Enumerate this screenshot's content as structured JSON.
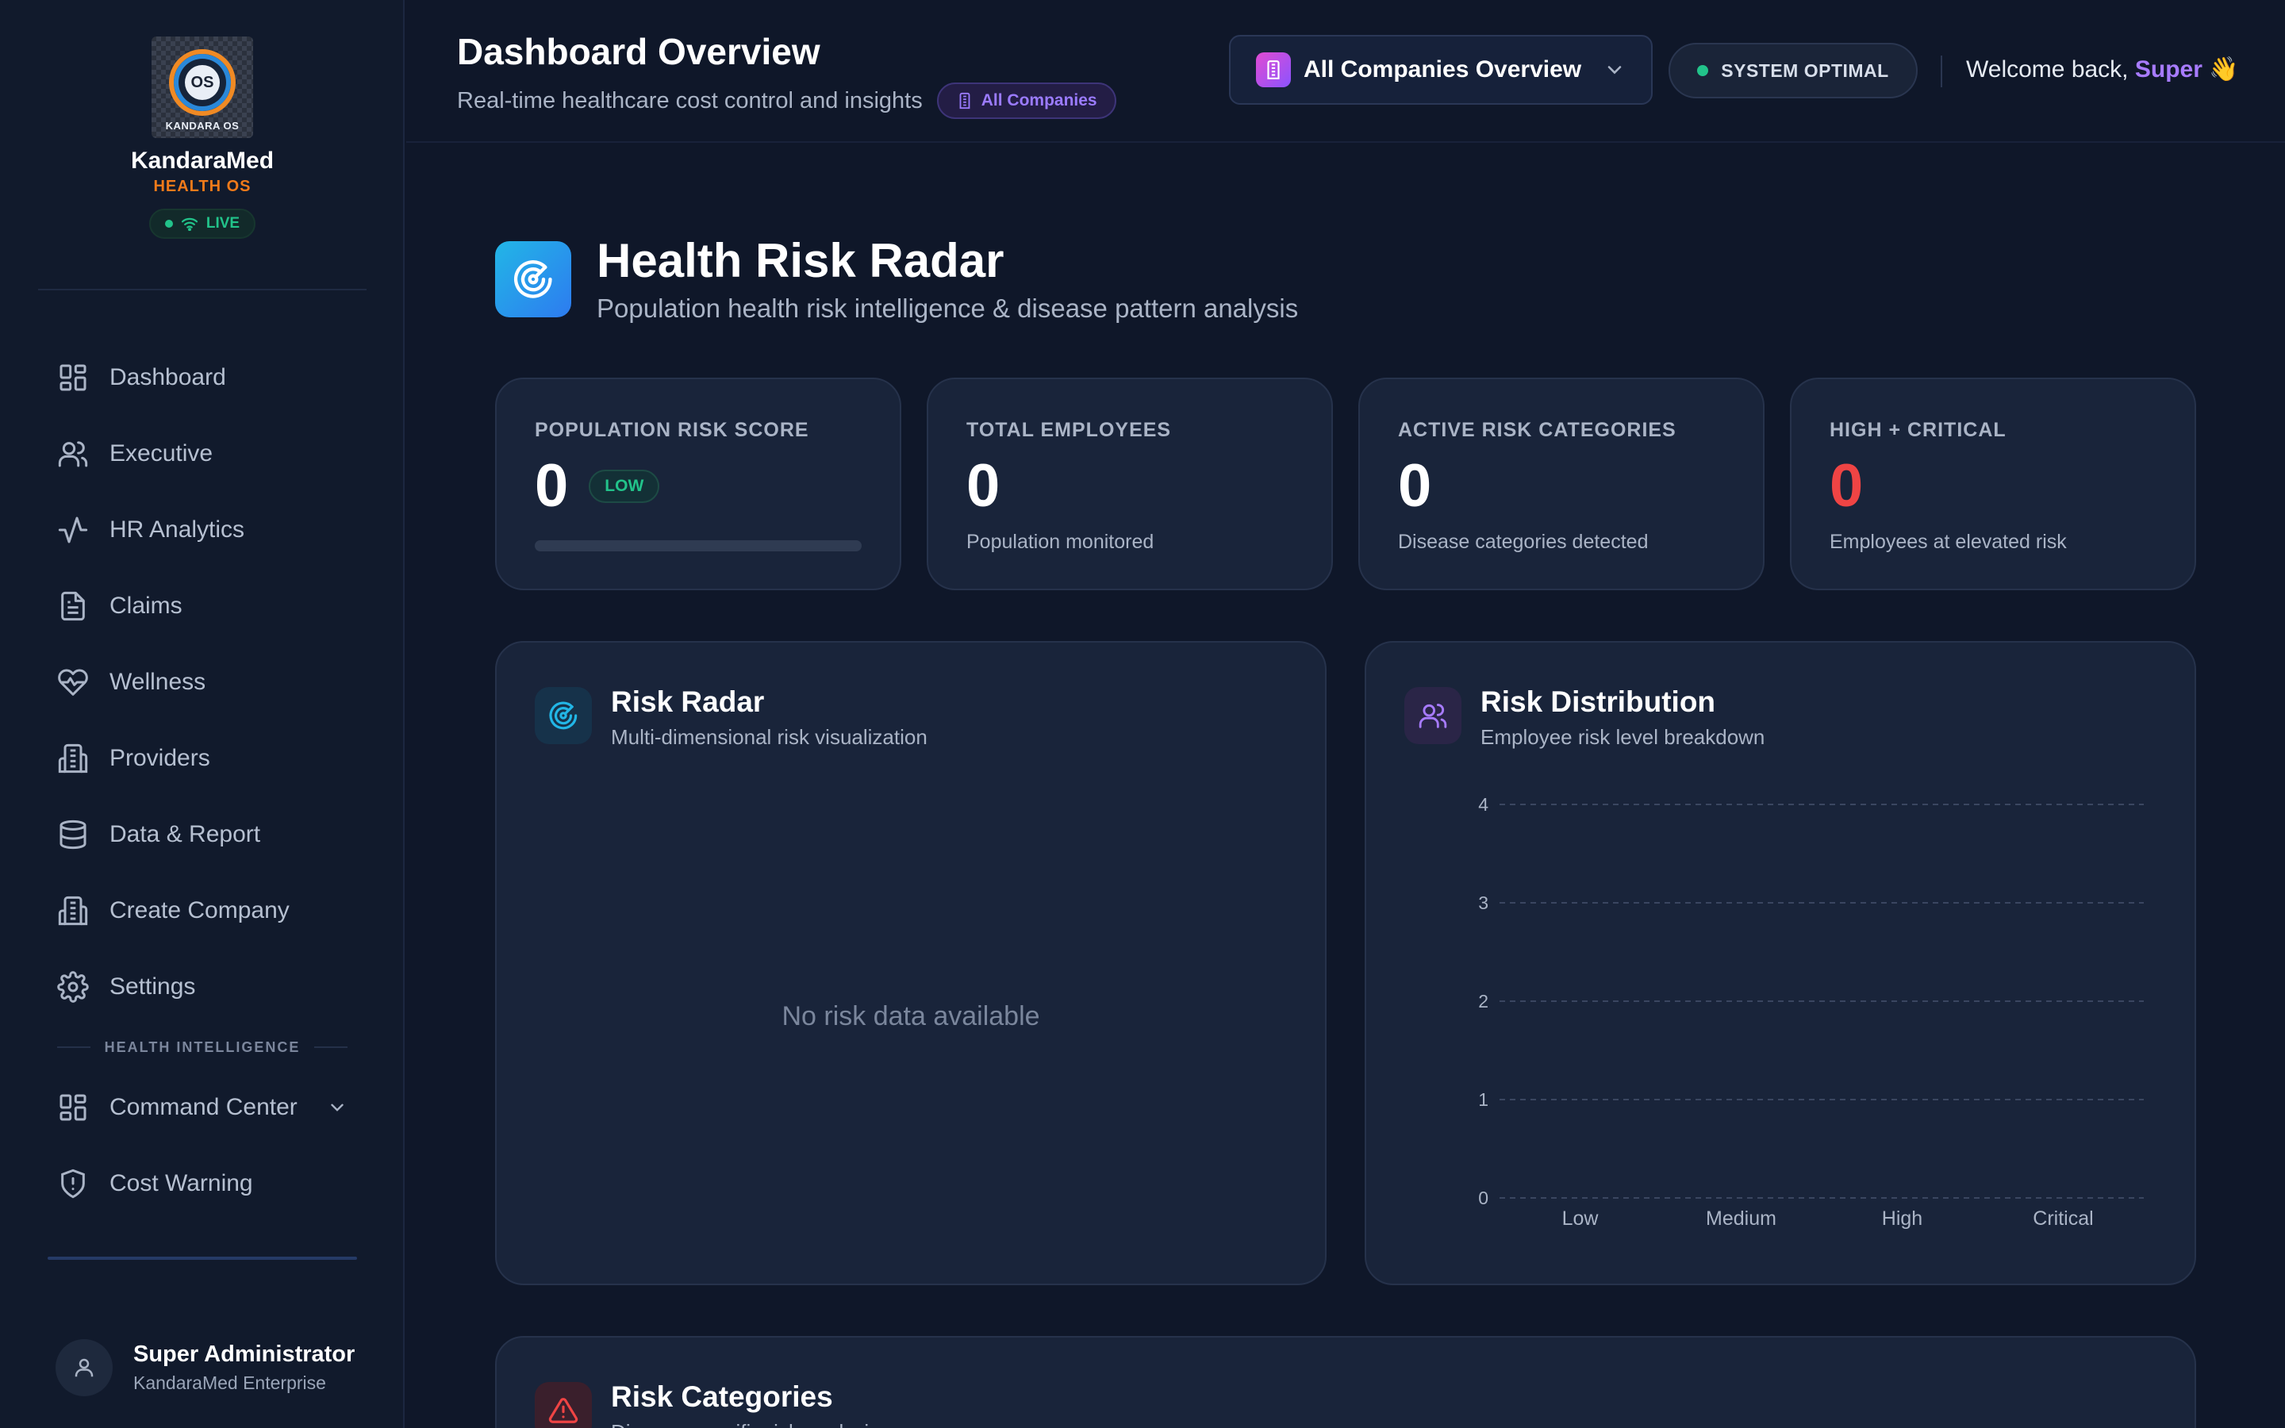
{
  "brand": {
    "logo_text": "OS",
    "logo_caption": "KANDARA OS",
    "name": "KandaraMed",
    "subtitle": "HEALTH OS",
    "live_label": "LIVE"
  },
  "sidebar": {
    "items": [
      {
        "label": "Dashboard",
        "icon": "dashboard-grid-icon"
      },
      {
        "label": "Executive",
        "icon": "users-icon"
      },
      {
        "label": "HR Analytics",
        "icon": "activity-icon"
      },
      {
        "label": "Claims",
        "icon": "document-icon"
      },
      {
        "label": "Wellness",
        "icon": "heart-pulse-icon"
      },
      {
        "label": "Providers",
        "icon": "building-icon"
      },
      {
        "label": "Data & Report",
        "icon": "database-icon"
      },
      {
        "label": "Create Company",
        "icon": "building-icon"
      },
      {
        "label": "Settings",
        "icon": "gear-icon"
      }
    ],
    "section_label": "HEALTH INTELLIGENCE",
    "intel_items": [
      {
        "label": "Command Center",
        "icon": "dashboard-grid-icon"
      },
      {
        "label": "Cost Warning",
        "icon": "shield-alert-icon"
      }
    ],
    "user": {
      "name": "Super Administrator",
      "org": "KandaraMed Enterprise"
    }
  },
  "header": {
    "title": "Dashboard Overview",
    "subtitle": "Real-time healthcare cost control and insights",
    "company_badge": "All Companies",
    "company_select": "All Companies Overview",
    "status": "SYSTEM OPTIMAL",
    "welcome_prefix": "Welcome back,",
    "welcome_name": "Super",
    "welcome_emoji": "👋"
  },
  "hero": {
    "title": "Health Risk Radar",
    "subtitle": "Population health risk intelligence & disease pattern analysis"
  },
  "stats": [
    {
      "label": "POPULATION RISK SCORE",
      "value": "0",
      "badge": "LOW",
      "progress": 0
    },
    {
      "label": "TOTAL EMPLOYEES",
      "value": "0",
      "desc": "Population monitored"
    },
    {
      "label": "ACTIVE RISK CATEGORIES",
      "value": "0",
      "desc": "Disease categories detected"
    },
    {
      "label": "HIGH + CRITICAL",
      "value": "0",
      "desc": "Employees at elevated risk"
    }
  ],
  "radar_panel": {
    "title": "Risk Radar",
    "subtitle": "Multi-dimensional risk visualization",
    "empty": "No risk data available"
  },
  "distribution_panel": {
    "title": "Risk Distribution",
    "subtitle": "Employee risk level breakdown"
  },
  "categories_panel": {
    "title": "Risk Categories",
    "subtitle": "Disease-specific risk analysis"
  },
  "chart_data": {
    "type": "bar",
    "categories": [
      "Low",
      "Medium",
      "High",
      "Critical"
    ],
    "values": [
      0,
      0,
      0,
      0
    ],
    "yticks": [
      "0",
      "1",
      "2",
      "3",
      "4"
    ],
    "ylim": [
      0,
      4
    ],
    "grid": true
  },
  "colors": {
    "accent": "#a77bff",
    "success": "#22c38a",
    "danger": "#ef4444",
    "brand_orange": "#f07a1a"
  }
}
